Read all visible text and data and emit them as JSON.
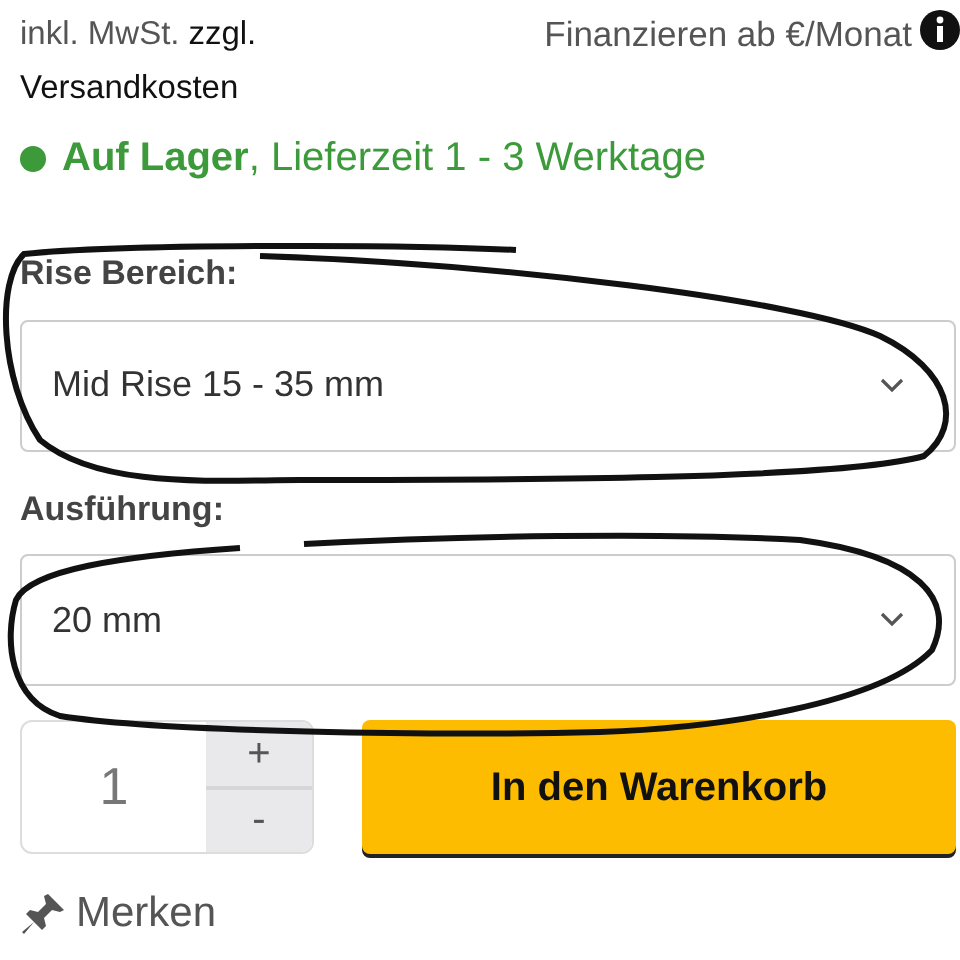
{
  "price_info": {
    "tax_note": "inkl. MwSt.",
    "shipping_link": "zzgl. Versandkosten",
    "financing": "Finanzieren ab €/Monat"
  },
  "stock": {
    "text": "**Auf Lager**, Lieferzeit 1 - 3 Werktage"
  },
  "options": [
    {
      "label": "Rise Bereich:",
      "value": "Mid Rise 15 - 35 mm"
    },
    {
      "label": "Ausführung:",
      "value": "20 mm"
    }
  ],
  "quantity": {
    "value": "1",
    "increase": "+",
    "decrease": "-"
  },
  "cart_button": "In den Warenkorb",
  "wishlist": "Merken"
}
